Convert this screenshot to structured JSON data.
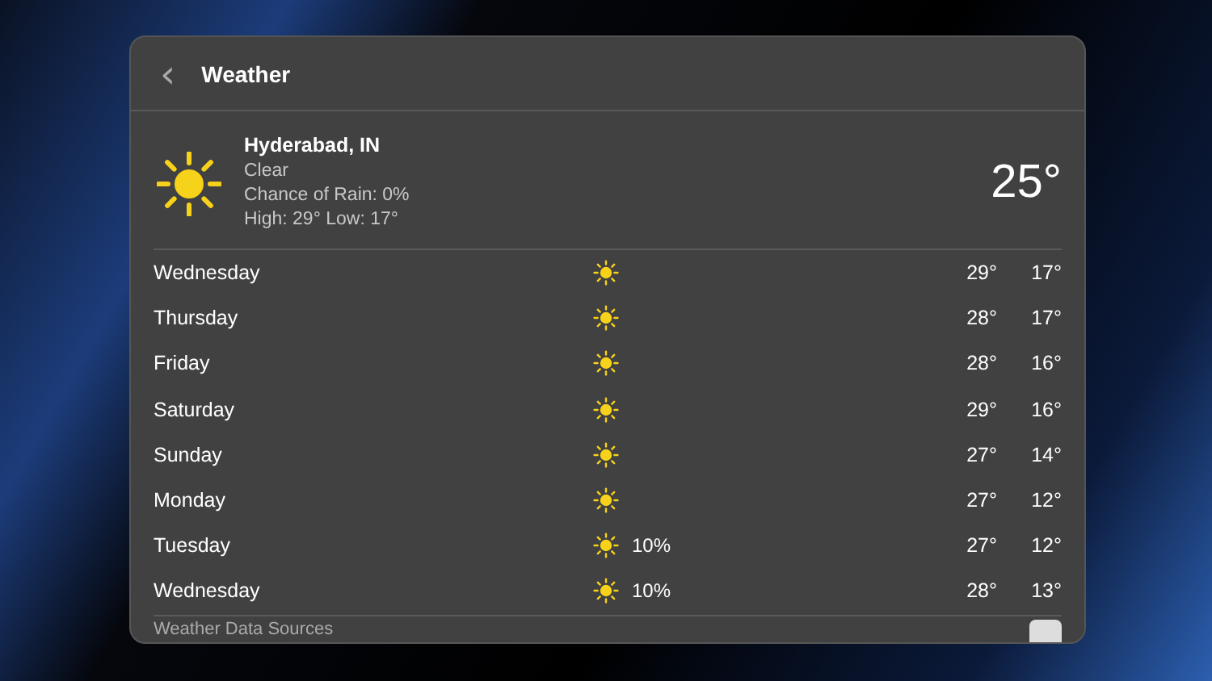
{
  "window": {
    "title": "Weather",
    "back": "‹"
  },
  "current": {
    "location": "Hyderabad, IN",
    "condition": "Clear",
    "rain": "Chance of Rain: 0%",
    "high_low": "High: 29° Low: 17°",
    "temperature": "25°"
  },
  "forecast": [
    {
      "day": "Wednesday",
      "high": "29°",
      "low": "17°"
    },
    {
      "day": "Thursday",
      "high": "28°",
      "low": "17°"
    },
    {
      "day": "Friday",
      "high": "28°",
      "low": "16°"
    },
    {
      "day": "Saturday",
      "high": "29°",
      "low": "16°"
    },
    {
      "day": "Sunday",
      "high": "27°",
      "low": "14°"
    },
    {
      "day": "Monday",
      "high": "27°",
      "low": "12°"
    },
    {
      "day": "Tuesday",
      "precipitation": "10%",
      "high": "27°",
      "low": "12°"
    },
    {
      "day": "Wednesday",
      "precipitation": "10%",
      "high": "28°",
      "low": "13°"
    }
  ],
  "footer": {
    "link": "Weather Data Sources"
  }
}
